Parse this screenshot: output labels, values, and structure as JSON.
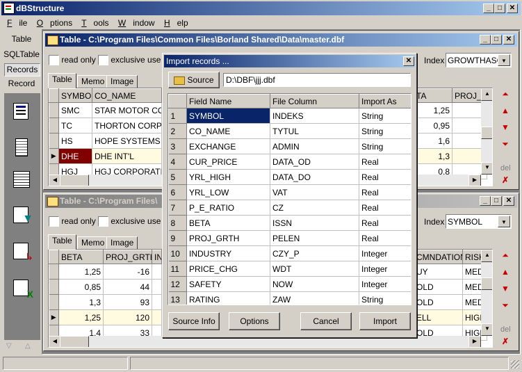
{
  "app": {
    "title": "dBStructure"
  },
  "menu": [
    "File",
    "Options",
    "Tools",
    "Window",
    "Help"
  ],
  "sidebar": {
    "items": [
      "Table",
      "SQLTable",
      "Records",
      "Record"
    ]
  },
  "win1": {
    "title": "Table - C:\\Program Files\\Common Files\\Borland Shared\\Data\\master.dbf",
    "read_only": "read only",
    "exclusive_use": "exclusive use",
    "index_label": "Index",
    "index_value": "GROWTHASC",
    "tabs": [
      "Table",
      "Memo",
      "Image"
    ],
    "left_headers": [
      "SYMBOL",
      "CO_NAME"
    ],
    "right_headers": [
      "TA",
      "PROJ_G"
    ],
    "rows": [
      [
        "SMC",
        "STAR MOTOR COR",
        "1,25",
        ""
      ],
      [
        "TC",
        "THORTON CORP",
        "0,95",
        ""
      ],
      [
        "HS",
        "HOPE SYSTEMS",
        "1,6",
        ""
      ],
      [
        "DHE",
        "DHE INT'L",
        "1,3",
        ""
      ],
      [
        "HGJ",
        "HGJ CORPORATION",
        "0,8",
        ""
      ]
    ],
    "del_label": "del"
  },
  "win2": {
    "title": "Table - C:\\Program Files\\",
    "read_only": "read only",
    "exclusive_use": "exclusive use",
    "index_label": "Index",
    "index_value": "SYMBOL",
    "tabs": [
      "Table",
      "Memo",
      "Image"
    ],
    "left_headers": [
      "BETA",
      "PROJ_GRTH",
      "IN"
    ],
    "right_headers": [
      "CMNDATION",
      "RISK"
    ],
    "rows": [
      [
        "1,25",
        "-16",
        "UY",
        "MED"
      ],
      [
        "0,85",
        "44",
        "OLD",
        "MED"
      ],
      [
        "1,3",
        "93",
        "OLD",
        "MED"
      ],
      [
        "1,25",
        "120",
        "ELL",
        "HIGH"
      ],
      [
        "1,4",
        "33",
        "OLD",
        "HIGH"
      ]
    ],
    "del_label": "del"
  },
  "dialog": {
    "title": "Import records ...",
    "source_button": "Source",
    "source_path": "D:\\DBF\\jjj.dbf",
    "headers": [
      "Field Name",
      "File Column",
      "Import As"
    ],
    "rows": [
      [
        "1",
        "SYMBOL",
        "INDEKS",
        "String"
      ],
      [
        "2",
        "CO_NAME",
        "TYTUL",
        "String"
      ],
      [
        "3",
        "EXCHANGE",
        "ADMIN",
        "String"
      ],
      [
        "4",
        "CUR_PRICE",
        "DATA_OD",
        "Real"
      ],
      [
        "5",
        "YRL_HIGH",
        "DATA_DO",
        "Real"
      ],
      [
        "6",
        "YRL_LOW",
        "VAT",
        "Real"
      ],
      [
        "7",
        "P_E_RATIO",
        "CZ",
        "Real"
      ],
      [
        "8",
        "BETA",
        "ISSN",
        "Real"
      ],
      [
        "9",
        "PROJ_GRTH",
        "PELEN",
        "Real"
      ],
      [
        "10",
        "INDUSTRY",
        "CZY_P",
        "Integer"
      ],
      [
        "11",
        "PRICE_CHG",
        "WDT",
        "Integer"
      ],
      [
        "12",
        "SAFETY",
        "NOW",
        "Integer"
      ],
      [
        "13",
        "RATING",
        "ZAW",
        "String"
      ]
    ],
    "buttons": {
      "source_info": "Source Info",
      "options": "Options",
      "cancel": "Cancel",
      "import": "Import"
    }
  }
}
